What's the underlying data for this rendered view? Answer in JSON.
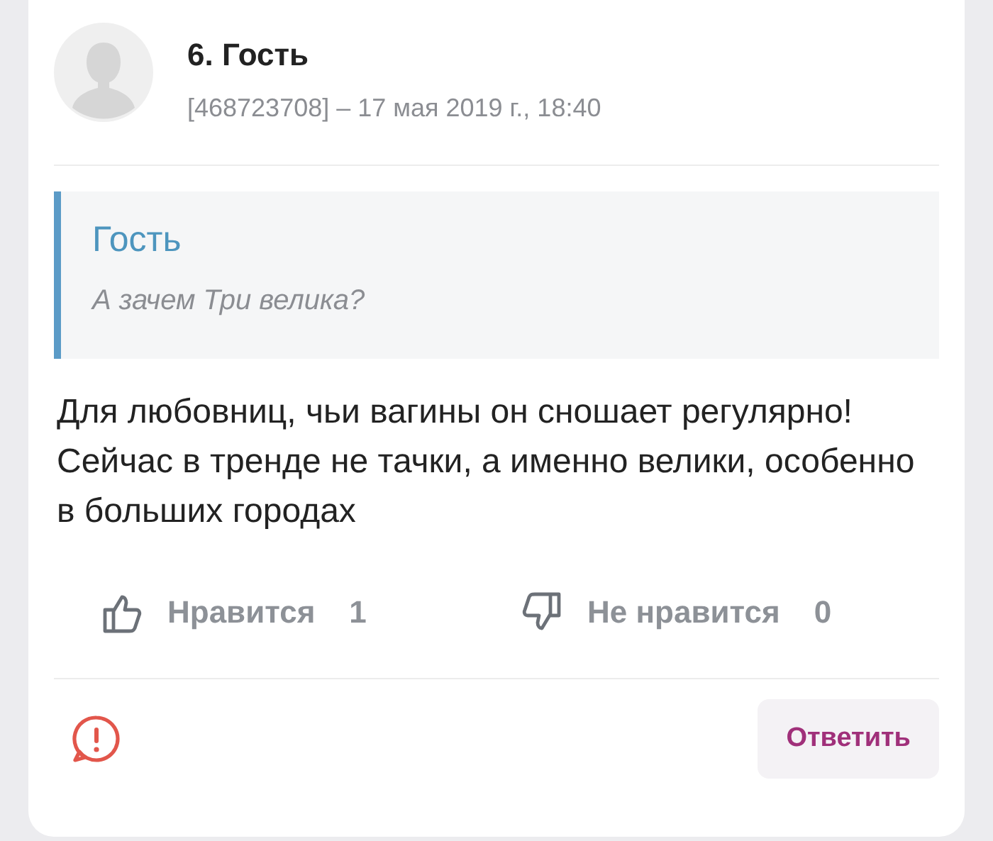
{
  "comment": {
    "number_name": "6. Гость",
    "meta": "[468723708] – 17 мая 2019 г., 18:40",
    "quote": {
      "author": "Гость",
      "text": "А зачем Три велика?"
    },
    "body": "Для любовниц, чьи вагины он сношает регулярно! Сейчас в тренде не тачки, а именно велики, особенно в больших городах",
    "reactions": [
      {
        "kind": "like",
        "label": "Нравится",
        "count": "1"
      },
      {
        "kind": "dislike",
        "label": "Не нравится",
        "count": "0"
      }
    ],
    "reply_button": "Ответить"
  }
}
